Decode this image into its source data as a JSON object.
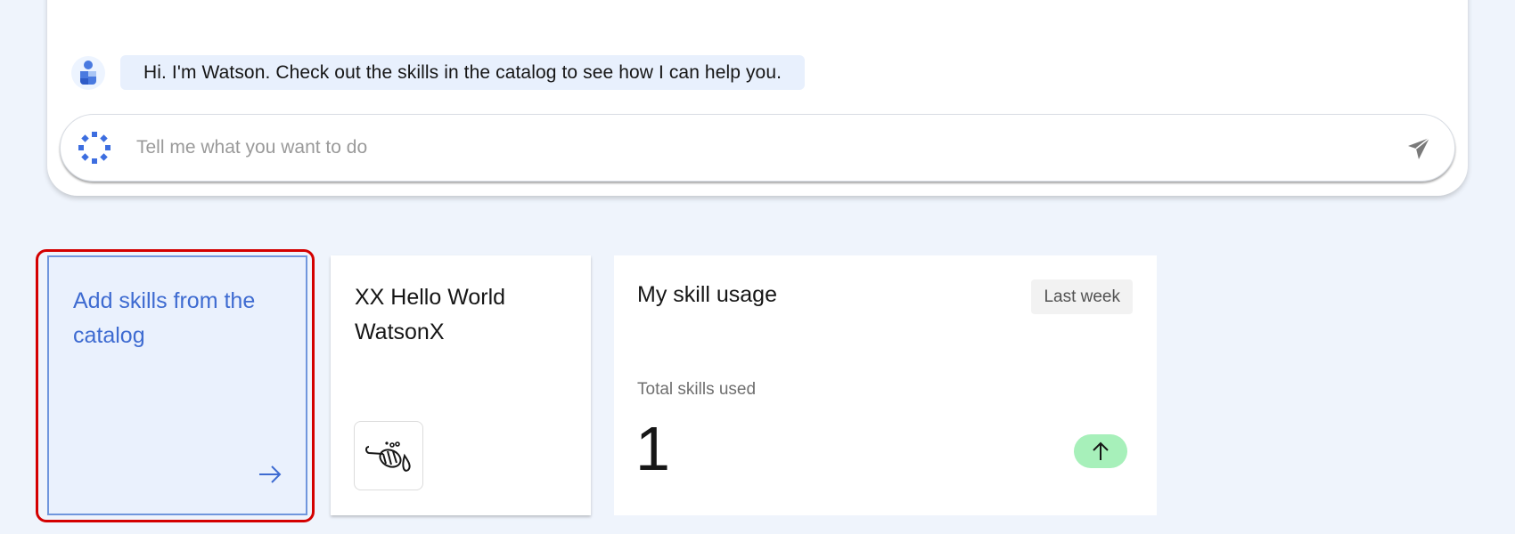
{
  "chat": {
    "assistant_message": "Hi. I'm Watson. Check out the skills in the catalog to see how I can help you.",
    "input_placeholder": "Tell me what you want to do",
    "input_value": ""
  },
  "tiles": {
    "add_skills": {
      "label": "Add skills from the catalog",
      "icon": "arrow-right-icon"
    },
    "skill": {
      "title": "XX Hello World WatsonX",
      "icon": "bee-icon"
    },
    "usage": {
      "title": "My skill usage",
      "period": "Last week",
      "metric_label": "Total skills used",
      "metric_value": "1",
      "trend_icon": "arrow-up-icon"
    }
  },
  "colors": {
    "page_background": "#eff4fc",
    "accent_blue": "#3e6bd1",
    "highlight_red": "#d40000",
    "trend_green": "#a7f0ba"
  }
}
